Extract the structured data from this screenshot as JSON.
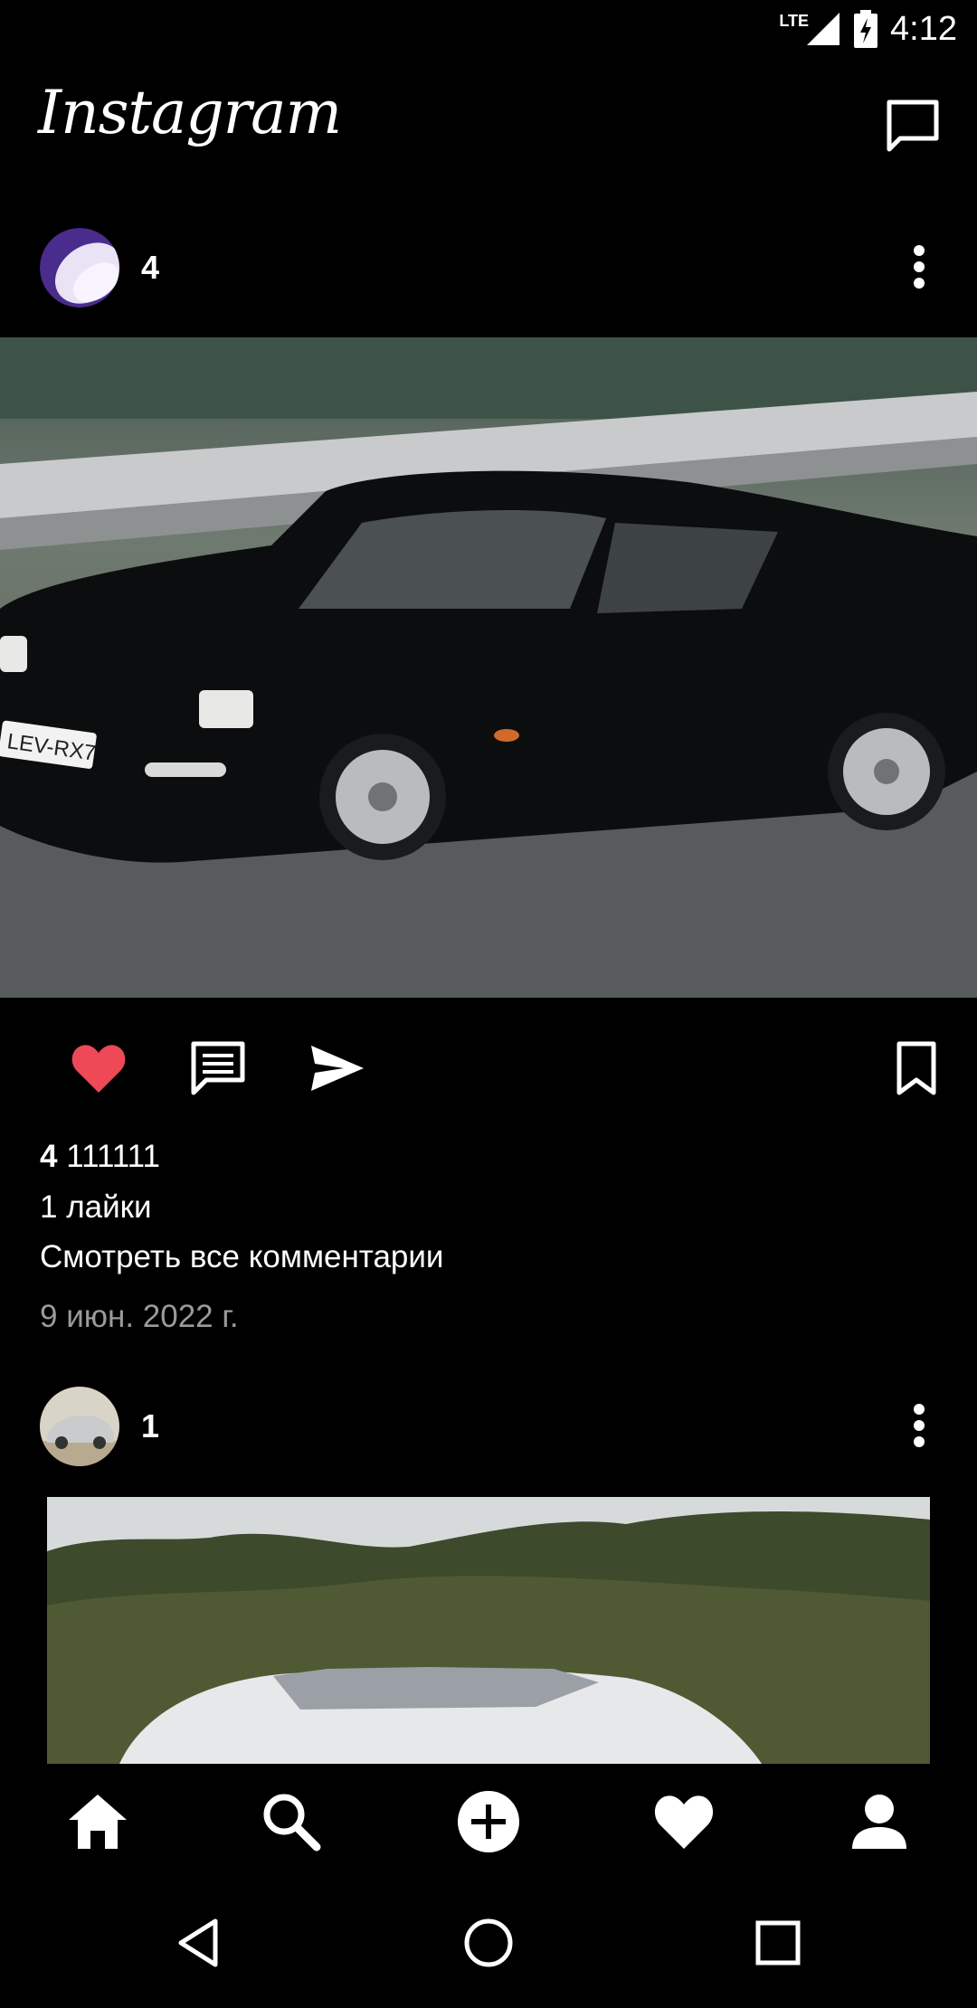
{
  "status_bar": {
    "network": "LTE",
    "time": "4:12"
  },
  "header": {
    "app_title": "Instagram"
  },
  "post1": {
    "username": "4",
    "caption_user": "4",
    "caption_text": "111111",
    "likes": "1 лайки",
    "view_comments": "Смотреть все комментарии",
    "date": "9 июн. 2022 г.",
    "liked": true,
    "plate_text": "LEV-RX7"
  },
  "post2": {
    "username": "1"
  },
  "icons": {
    "direct": "message-icon",
    "more": "more-vert-icon",
    "like": "heart-icon",
    "comment": "comment-icon",
    "share": "send-icon",
    "save": "bookmark-icon",
    "nav": [
      "home-icon",
      "search-icon",
      "add-icon",
      "activity-heart-icon",
      "profile-icon"
    ],
    "system": [
      "back-icon",
      "home-circle-icon",
      "recents-icon"
    ]
  },
  "colors": {
    "like_red": "#ED4956",
    "background": "#000000",
    "date_grey": "#9A9A9A"
  }
}
